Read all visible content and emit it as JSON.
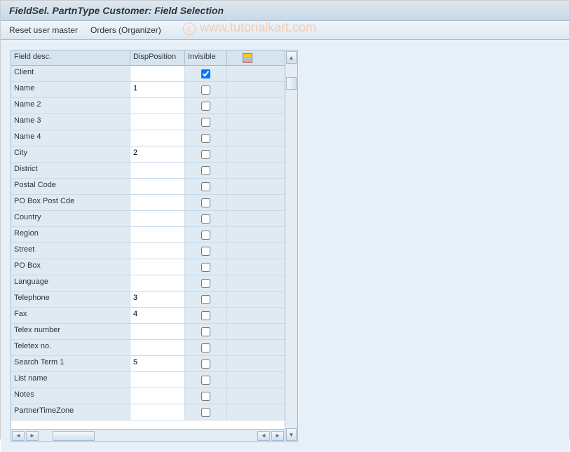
{
  "title": "FieldSel. PartnType Customer: Field Selection",
  "toolbar": {
    "reset": "Reset user master",
    "orders": "Orders (Organizer)"
  },
  "watermark": "www.tutorialkart.com",
  "table": {
    "headers": {
      "field": "Field desc.",
      "position": "DispPosition",
      "invisible": "Invisible"
    },
    "rows": [
      {
        "field": "Client",
        "position": "",
        "invisible": true
      },
      {
        "field": "Name",
        "position": "1",
        "invisible": false
      },
      {
        "field": "Name 2",
        "position": "",
        "invisible": false
      },
      {
        "field": "Name 3",
        "position": "",
        "invisible": false
      },
      {
        "field": "Name 4",
        "position": "",
        "invisible": false
      },
      {
        "field": "City",
        "position": "2",
        "invisible": false
      },
      {
        "field": "District",
        "position": "",
        "invisible": false
      },
      {
        "field": "Postal Code",
        "position": "",
        "invisible": false
      },
      {
        "field": "PO Box Post Cde",
        "position": "",
        "invisible": false
      },
      {
        "field": "Country",
        "position": "",
        "invisible": false
      },
      {
        "field": "Region",
        "position": "",
        "invisible": false
      },
      {
        "field": "Street",
        "position": "",
        "invisible": false
      },
      {
        "field": "PO Box",
        "position": "",
        "invisible": false
      },
      {
        "field": "Language",
        "position": "",
        "invisible": false
      },
      {
        "field": "Telephone",
        "position": "3",
        "invisible": false
      },
      {
        "field": "Fax",
        "position": "4",
        "invisible": false
      },
      {
        "field": "Telex number",
        "position": "",
        "invisible": false
      },
      {
        "field": "Teletex no.",
        "position": "",
        "invisible": false
      },
      {
        "field": "Search Term 1",
        "position": "5",
        "invisible": false
      },
      {
        "field": "List name",
        "position": "",
        "invisible": false
      },
      {
        "field": "Notes",
        "position": "",
        "invisible": false
      },
      {
        "field": "PartnerTimeZone",
        "position": "",
        "invisible": false
      }
    ]
  }
}
